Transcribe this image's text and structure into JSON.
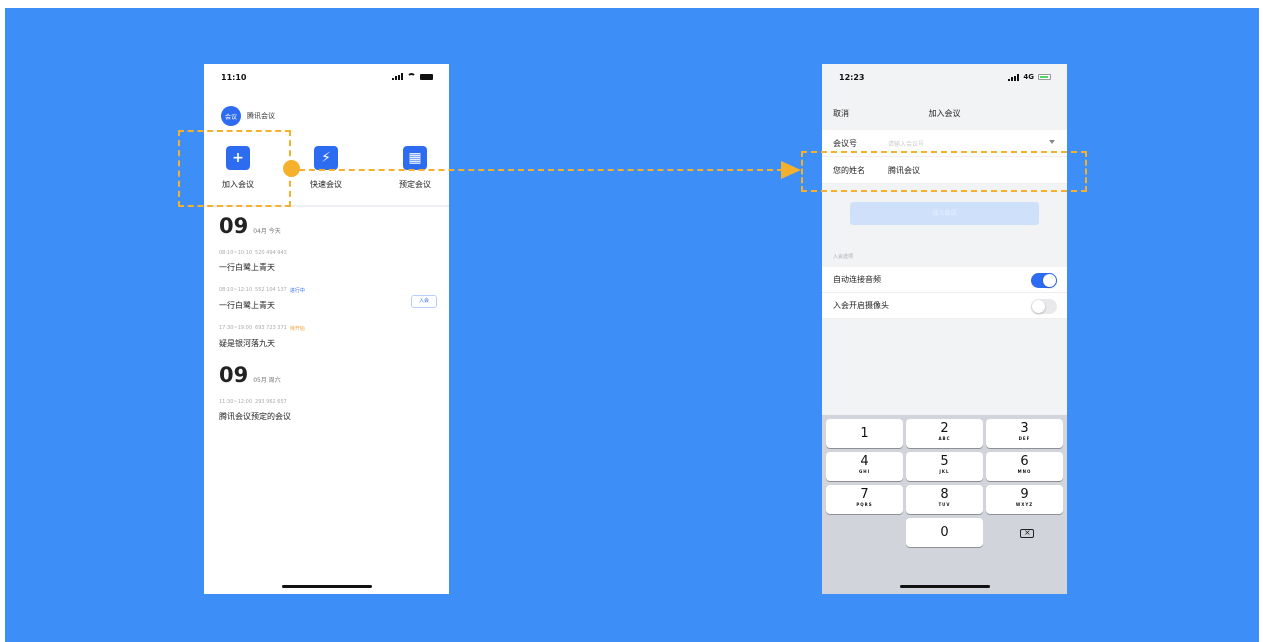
{
  "left_phone": {
    "status_time": "11:10",
    "app_logo": "会议",
    "app_name": "腾讯会议",
    "actions": [
      {
        "label": "加入会议",
        "icon": "+"
      },
      {
        "label": "快速会议",
        "icon": "⚡"
      },
      {
        "label": "预定会议",
        "icon": "▦"
      }
    ],
    "days": [
      {
        "num": "09",
        "sub": "04月 今天",
        "meetings": [
          {
            "time": "08:10~10:10",
            "id": "520 494 943",
            "tag": "",
            "title": "一行白鹭上青天"
          },
          {
            "time": "08:10~12:10",
            "id": "552 104 137",
            "tag": "进行中",
            "title": "一行白鹭上青天",
            "join": "入会"
          },
          {
            "time": "17:30~19:00",
            "id": "693 723 371",
            "tag": "待开始",
            "title": "疑是银河落九天"
          }
        ]
      },
      {
        "num": "09",
        "sub": "05月 周六",
        "meetings": [
          {
            "time": "11:30~12:00",
            "id": "293 962 657",
            "tag": "",
            "title": "腾讯会议预定的会议"
          }
        ]
      }
    ]
  },
  "right_phone": {
    "status_time": "12:23",
    "network": "4G",
    "nav_cancel": "取消",
    "nav_title": "加入会议",
    "meeting_id_label": "会议号",
    "meeting_id_placeholder": "请输入会议号",
    "name_label": "您的姓名",
    "name_value": "腾讯会议",
    "enter_button": "加入会议",
    "section_title": "入会选项",
    "toggle_audio_label": "自动连接音频",
    "toggle_audio_on": true,
    "toggle_camera_label": "入会开启摄像头",
    "toggle_camera_on": false,
    "keypad": [
      {
        "d": "1",
        "l": ""
      },
      {
        "d": "2",
        "l": "ABC"
      },
      {
        "d": "3",
        "l": "DEF"
      },
      {
        "d": "4",
        "l": "GHI"
      },
      {
        "d": "5",
        "l": "JKL"
      },
      {
        "d": "6",
        "l": "MNO"
      },
      {
        "d": "7",
        "l": "PQRS"
      },
      {
        "d": "8",
        "l": "TUV"
      },
      {
        "d": "9",
        "l": "WXYZ"
      },
      {
        "d": "0",
        "l": ""
      }
    ]
  },
  "colors": {
    "background": "#3d8ef6",
    "brand_blue": "#2d6cf1",
    "annotation": "#f5b12e",
    "status_in_progress": "#2d6cf1",
    "status_pending": "#f0a33a"
  }
}
